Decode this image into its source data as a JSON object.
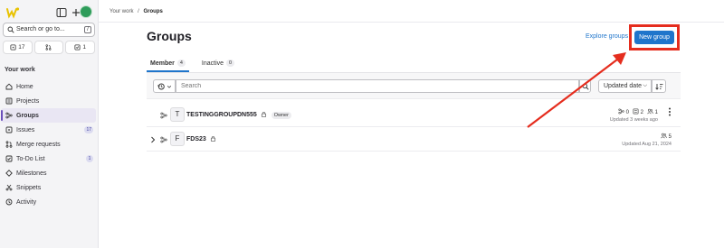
{
  "sidebar": {
    "search_label": "Search or go to...",
    "counts": [
      {
        "icon": "issues-icon",
        "value": "17"
      },
      {
        "icon": "merge-request-icon",
        "value": ""
      },
      {
        "icon": "todo-icon",
        "value": "1"
      }
    ],
    "section_title": "Your work",
    "items": [
      {
        "label": "Home",
        "icon": "home-icon",
        "badge": ""
      },
      {
        "label": "Projects",
        "icon": "project-icon",
        "badge": ""
      },
      {
        "label": "Groups",
        "icon": "group-icon",
        "badge": "",
        "active": true
      },
      {
        "label": "Issues",
        "icon": "issues-icon",
        "badge": "17"
      },
      {
        "label": "Merge requests",
        "icon": "merge-request-icon",
        "badge": ""
      },
      {
        "label": "To-Do List",
        "icon": "todo-icon",
        "badge": "1"
      },
      {
        "label": "Milestones",
        "icon": "milestone-icon",
        "badge": ""
      },
      {
        "label": "Snippets",
        "icon": "snippet-icon",
        "badge": ""
      },
      {
        "label": "Activity",
        "icon": "activity-icon",
        "badge": ""
      }
    ]
  },
  "breadcrumb": {
    "parent": "Your work",
    "separator": "/",
    "current": "Groups"
  },
  "page": {
    "title": "Groups",
    "explore_label": "Explore groups",
    "new_group_label": "New group"
  },
  "tabs": [
    {
      "label": "Member",
      "count": "4",
      "active": true
    },
    {
      "label": "Inactive",
      "count": "0",
      "active": false
    }
  ],
  "filter": {
    "search_placeholder": "Search",
    "sort_label": "Updated date"
  },
  "groups": [
    {
      "avatar": "T",
      "name": "TESTINGGROUPDN555",
      "role": "Owner",
      "subgroups": "0",
      "projects": "2",
      "members": "1",
      "updated": "Updated 3 weeks ago"
    },
    {
      "avatar": "F",
      "name": "FDS23",
      "role": "",
      "members": "5",
      "updated": "Updated Aug 21, 2024"
    }
  ],
  "colors": {
    "accent": "#1f75cb",
    "annotation": "#e52d1e",
    "active_nav": "#6b4fbb"
  }
}
